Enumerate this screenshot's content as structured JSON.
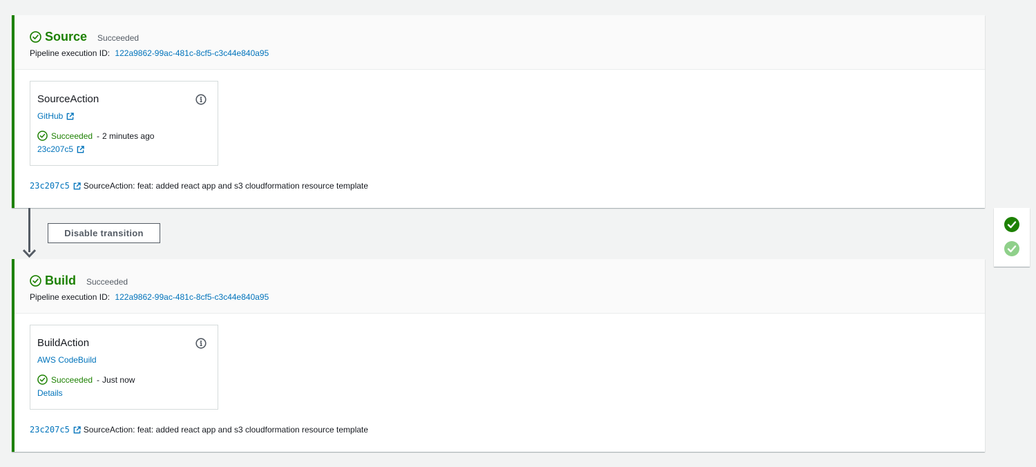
{
  "colors": {
    "success": "#1d8102",
    "link": "#0073bb",
    "text": "#16191f",
    "muted": "#545b64"
  },
  "stages": {
    "source": {
      "title": "Source",
      "status": "Succeeded",
      "exec_label": "Pipeline execution ID:",
      "exec_id": "122a9862-99ac-481c-8cf5-c3c44e840a95",
      "action": {
        "name": "SourceAction",
        "provider": "GitHub",
        "status": "Succeeded",
        "separator": "-",
        "time": "2 minutes ago",
        "link": "23c207c5"
      },
      "commit": {
        "id": "23c207c5",
        "message": "SourceAction: feat: added react app and s3 cloudformation resource template"
      }
    },
    "build": {
      "title": "Build",
      "status": "Succeeded",
      "exec_label": "Pipeline execution ID:",
      "exec_id": "122a9862-99ac-481c-8cf5-c3c44e840a95",
      "action": {
        "name": "BuildAction",
        "provider": "AWS CodeBuild",
        "status": "Succeeded",
        "separator": "-",
        "time": "Just now",
        "link": "Details"
      },
      "commit": {
        "id": "23c207c5",
        "message": "SourceAction: feat: added react app and s3 cloudformation resource template"
      }
    }
  },
  "transition": {
    "button_label": "Disable transition"
  },
  "icons": {
    "stage_status": "success-circle-icon",
    "info": "info-icon",
    "external": "external-link-icon",
    "side_checks": [
      "check-filled-icon",
      "check-faded-icon"
    ]
  }
}
